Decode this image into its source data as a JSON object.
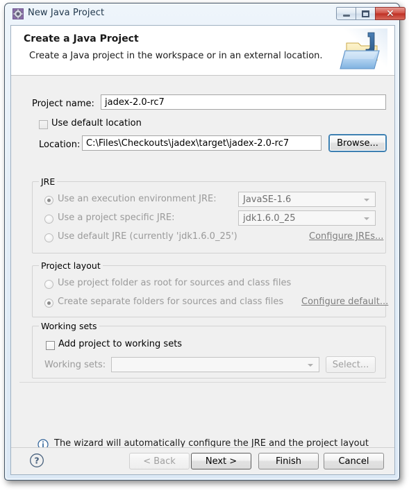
{
  "window": {
    "title": "New Java Project",
    "icon": "java-project-wizard-icon",
    "controls": {
      "minimize": "minimize-icon",
      "maximize": "maximize-icon",
      "close": "✕"
    }
  },
  "banner": {
    "title": "Create a Java Project",
    "description": "Create a Java project in the workspace or in an external location.",
    "icon": "java-project-folder-icon"
  },
  "form": {
    "project_name_label": "Project name:",
    "project_name_value": "jadex-2.0-rc7",
    "use_default_location_label": "Use default location",
    "use_default_location_checked": false,
    "location_label": "Location:",
    "location_value": "C:\\Files\\Checkouts\\jadex\\target\\jadex-2.0-rc7",
    "browse_label": "Browse..."
  },
  "jre": {
    "group_title": "JRE",
    "option_execution_env_label": "Use an execution environment JRE:",
    "option_execution_env_selected": true,
    "execution_env_value": "JavaSE-1.6",
    "option_project_specific_label": "Use a project specific JRE:",
    "option_project_specific_selected": false,
    "project_specific_value": "jdk1.6.0_25",
    "option_default_jre_label": "Use default JRE (currently 'jdk1.6.0_25')",
    "option_default_jre_selected": false,
    "configure_jres_link": "Configure JREs..."
  },
  "project_layout": {
    "group_title": "Project layout",
    "option_project_folder_label": "Use project folder as root for sources and class files",
    "option_project_folder_selected": false,
    "option_separate_folders_label": "Create separate folders for sources and class files",
    "option_separate_folders_selected": true,
    "configure_default_link": "Configure default..."
  },
  "working_sets": {
    "group_title": "Working sets",
    "add_to_working_sets_label": "Add project to working sets",
    "add_to_working_sets_checked": false,
    "working_sets_label": "Working sets:",
    "working_sets_value": "",
    "select_label": "Select..."
  },
  "info": {
    "icon": "info-icon",
    "message": "The wizard will automatically configure the JRE and the project layout based on the existing source."
  },
  "footer": {
    "help_icon": "help-icon",
    "back_label": "< Back",
    "next_label": "Next >",
    "finish_label": "Finish",
    "cancel_label": "Cancel"
  },
  "colors": {
    "accent_blue": "#3c7fb1",
    "info_blue": "#2a5e96",
    "dialog_bg": "#f0f0f0",
    "banner_bg": "#ffffff",
    "close_red": "#bf3125"
  }
}
